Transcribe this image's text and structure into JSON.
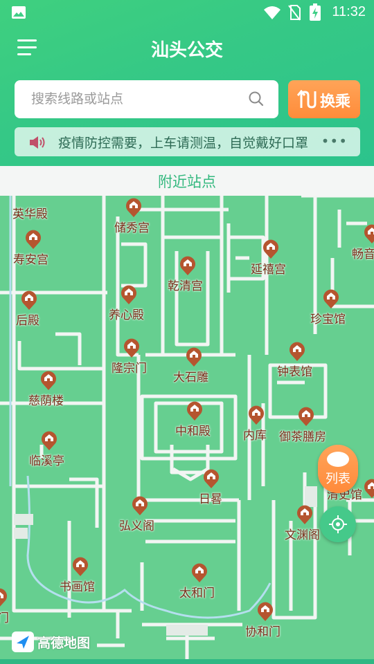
{
  "status_bar": {
    "time": "11:32"
  },
  "header": {
    "title": "汕头公交",
    "search_placeholder": "搜索线路或站点",
    "transfer_label": "换乘",
    "notice_text": "疫情防控需要，上车请测温，自觉戴好口罩",
    "more_label": "•••"
  },
  "nearby": {
    "title": "附近站点"
  },
  "map": {
    "pois": [
      {
        "label": "英华殿"
      },
      {
        "label": "储秀宫"
      },
      {
        "label": "寿安宫"
      },
      {
        "label": "乾清宫"
      },
      {
        "label": "延禧宫"
      },
      {
        "label": "畅音"
      },
      {
        "label": "后殿"
      },
      {
        "label": "养心殿"
      },
      {
        "label": "珍宝馆"
      },
      {
        "label": "隆宗门"
      },
      {
        "label": "大石雕"
      },
      {
        "label": "钟表馆"
      },
      {
        "label": "慈荫楼"
      },
      {
        "label": "中和殿"
      },
      {
        "label": "内库"
      },
      {
        "label": "御茶膳房"
      },
      {
        "label": "临溪亭"
      },
      {
        "label": "日晷"
      },
      {
        "label": "弘义阁"
      },
      {
        "label": "清史馆"
      },
      {
        "label": "文渊阁"
      },
      {
        "label": "书画馆"
      },
      {
        "label": "太和门"
      },
      {
        "label": "协和门"
      },
      {
        "label": "门"
      }
    ],
    "list_button_label": "列表",
    "logo_text": "高德地图"
  },
  "colors": {
    "accent": "#35c886",
    "orange": "#ff8c3a",
    "poi_pin": "#b5552f",
    "map": "#66cf90"
  }
}
